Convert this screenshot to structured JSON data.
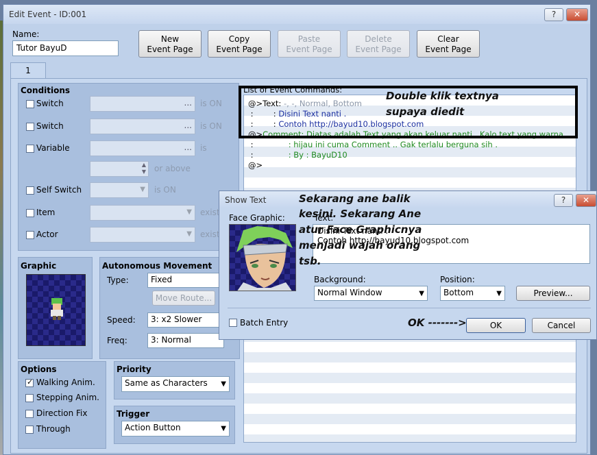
{
  "edit_event": {
    "title": "Edit Event - ID:001",
    "help_btn": "?",
    "close_btn": "✕",
    "name_label": "Name:",
    "name_value": "Tutor BayuD",
    "buttons": {
      "new1": "New",
      "new2": "Event Page",
      "copy1": "Copy",
      "copy2": "Event Page",
      "paste1": "Paste",
      "paste2": "Event Page",
      "delete1": "Delete",
      "delete2": "Event Page",
      "clear1": "Clear",
      "clear2": "Event Page"
    },
    "tab": "1",
    "conditions": {
      "title": "Conditions",
      "switch1": "Switch",
      "switch1_status": "is ON",
      "switch2": "Switch",
      "switch2_status": "is ON",
      "variable": "Variable",
      "variable_status": "is",
      "or_above": "or above",
      "self_switch": "Self Switch",
      "self_switch_status": "is ON",
      "item": "Item",
      "item_status": "exist",
      "actor": "Actor",
      "actor_status": "exist",
      "dots": "..."
    },
    "graphic": {
      "title": "Graphic"
    },
    "autonomous": {
      "title": "Autonomous Movement",
      "type_label": "Type:",
      "type_value": "Fixed",
      "move_route": "Move Route...",
      "speed_label": "Speed:",
      "speed_value": "3: x2 Slower",
      "freq_label": "Freq:",
      "freq_value": "3: Normal"
    },
    "options": {
      "title": "Options",
      "walking": "Walking Anim.",
      "walking_checked": "✓",
      "stepping": "Stepping Anim.",
      "direction": "Direction Fix",
      "through": "Through"
    },
    "priority": {
      "title": "Priority",
      "value": "Same as Characters"
    },
    "trigger": {
      "title": "Trigger",
      "value": "Action Button"
    },
    "commands": {
      "title": "List of Event Commands:",
      "l1a": "@>Text: ",
      "l1b": "-, -, Normal, Bottom",
      "l2a": " :        : ",
      "l2b": "Disini Text nanti .",
      "l3a": " :        : ",
      "l3b": "Contoh http://bayud10.blogspot.com",
      "l4a": "@>",
      "l4b": "Comment: Diatas adalah Text yang akan keluar nanti . Kalo text yang warna",
      "l5a": " :              ",
      "l5b": ": hijau ini cuma Comment .. Gak terlalu berguna sih .",
      "l6a": " :              ",
      "l6b": ": By : BayuD10",
      "l7": "@>"
    }
  },
  "show_text": {
    "title": "Show Text",
    "help_btn": "?",
    "close_btn": "✕",
    "face_label": "Face Graphic:",
    "text_label": "Text:",
    "text_line1": "Disini Text nanti .",
    "text_line2": "Contoh http://bayud10.blogspot.com",
    "background_label": "Background:",
    "background_value": "Normal Window",
    "position_label": "Position:",
    "position_value": "Bottom",
    "preview": "Preview...",
    "batch": "Batch Entry",
    "ok": "OK",
    "cancel": "Cancel"
  },
  "annotations": {
    "a1": "Double klik textnya",
    "a2": "supaya diedit",
    "b1": "Sekarang ane balik",
    "b2": "kesini. Sekarang Ane",
    "b3": "atur Face Graphicnya",
    "b4": "menjadi wajah orang",
    "b5": "tsb.",
    "ok_arrow": "OK ------->"
  }
}
